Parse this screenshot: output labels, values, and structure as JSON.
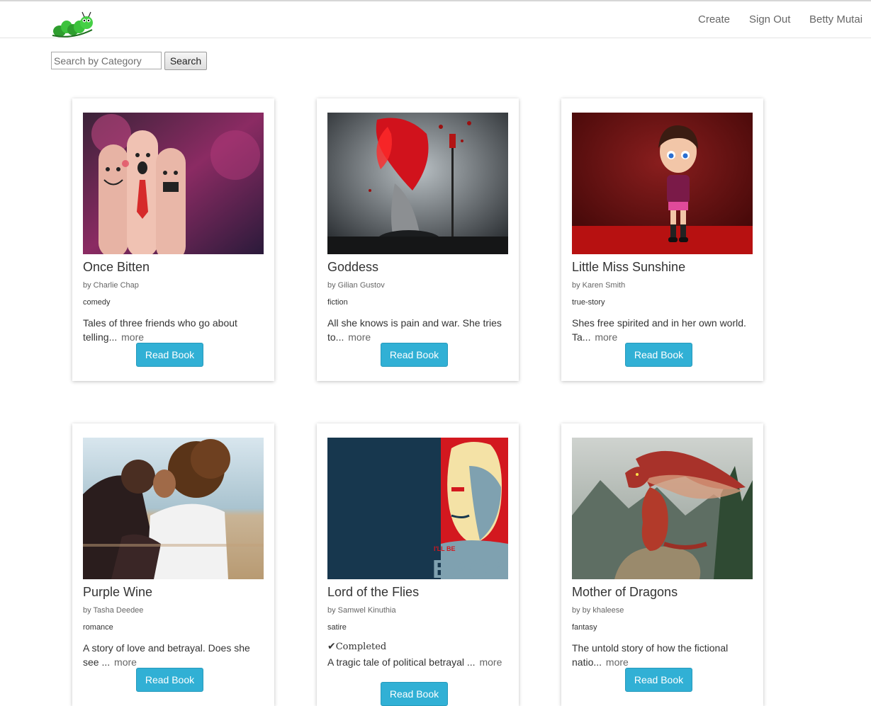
{
  "nav": {
    "links": [
      "Create",
      "Sign Out",
      "Betty Mutai"
    ]
  },
  "search": {
    "placeholder": "Search by Category",
    "button_label": "Search"
  },
  "books": [
    {
      "title": "Once Bitten",
      "author": "by Charlie Chap",
      "category": "comedy",
      "status": "",
      "description": "Tales of three friends who go about telling...",
      "more": "more",
      "button": "Read Book"
    },
    {
      "title": "Goddess",
      "author": "by Gilian Gustov",
      "category": "fiction",
      "status": "",
      "description": "All she knows is pain and war. She tries to...",
      "more": "more",
      "button": "Read Book"
    },
    {
      "title": "Little Miss Sunshine",
      "author": "by Karen Smith",
      "category": "true-story",
      "status": "",
      "description": "Shes free spirited and in her own world. Ta...",
      "more": "more",
      "button": "Read Book"
    },
    {
      "title": "Purple Wine",
      "author": "by Tasha Deedee",
      "category": "romance",
      "status": "",
      "description": "A story of love and betrayal. Does she see ...",
      "more": "more",
      "button": "Read Book"
    },
    {
      "title": "Lord of the Flies",
      "author": "by Samwel Kinuthia",
      "category": "satire",
      "status": "Completed",
      "description": "A tragic tale of political betrayal ...",
      "more": "more",
      "button": "Read Book"
    },
    {
      "title": "Mother of Dragons",
      "author": "by by khaleese",
      "category": "fantasy",
      "status": "",
      "description": "The untold story of how the fictional natio...",
      "more": "more",
      "button": "Read Book"
    }
  ],
  "covers": {
    "book5_poster_text_small": "I'LL BE",
    "book5_poster_text_large": "BACK"
  },
  "colors": {
    "button": "#31b0d5",
    "logo": "#2db52d"
  }
}
